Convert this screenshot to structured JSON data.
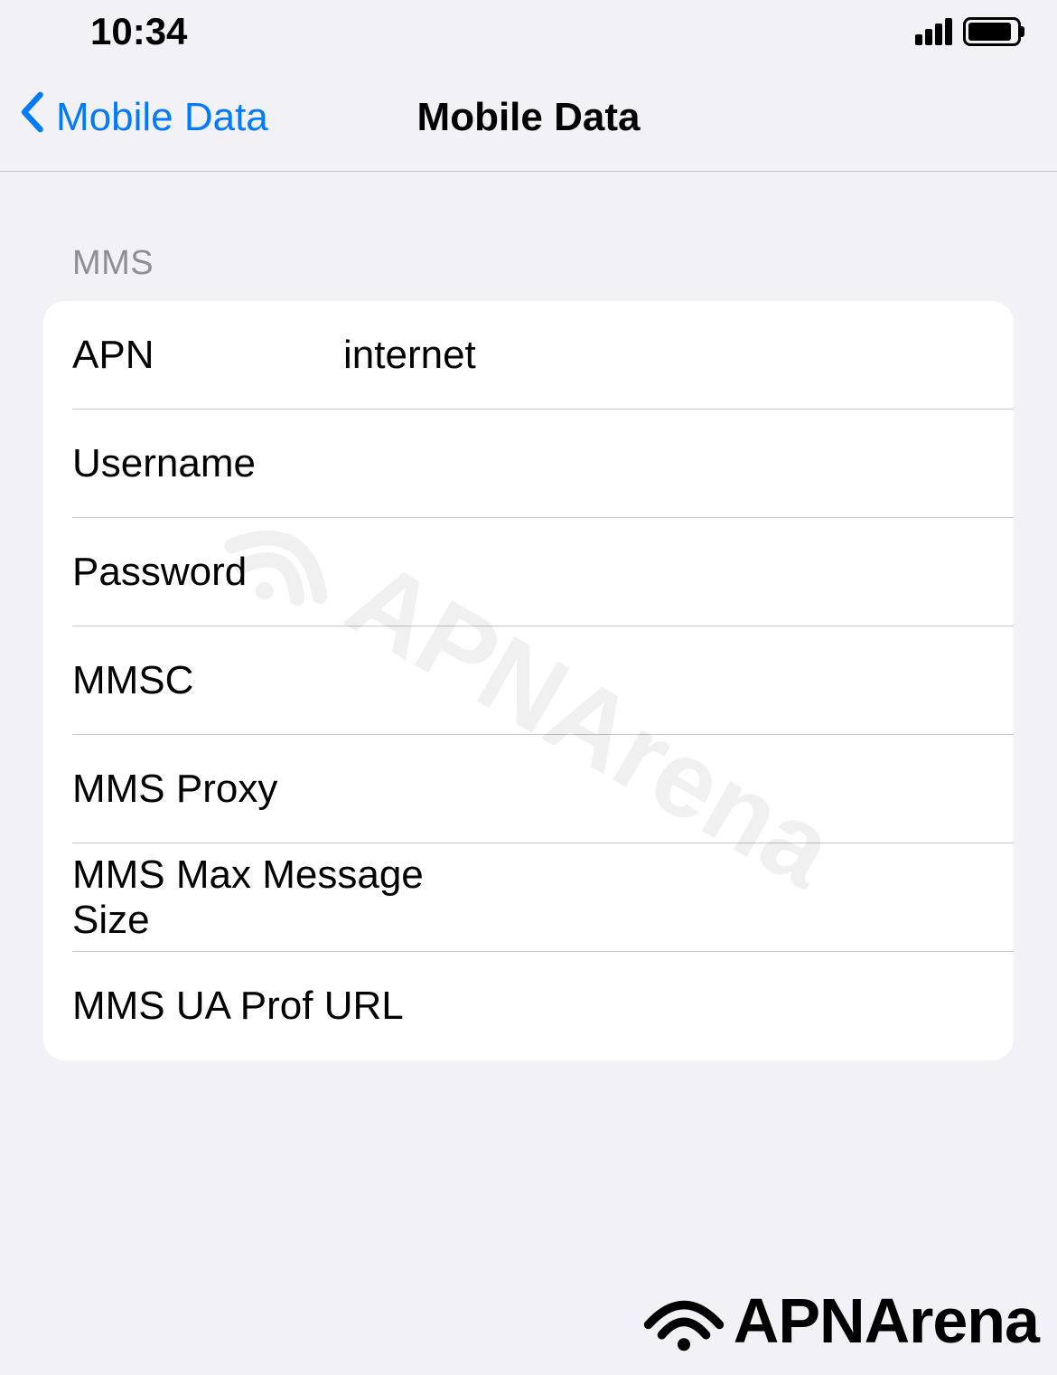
{
  "statusBar": {
    "time": "10:34"
  },
  "navBar": {
    "backLabel": "Mobile Data",
    "title": "Mobile Data"
  },
  "section": {
    "header": "MMS",
    "rows": [
      {
        "label": "APN",
        "value": "internet"
      },
      {
        "label": "Username",
        "value": ""
      },
      {
        "label": "Password",
        "value": ""
      },
      {
        "label": "MMSC",
        "value": ""
      },
      {
        "label": "MMS Proxy",
        "value": ""
      },
      {
        "label": "MMS Max Message Size",
        "value": ""
      },
      {
        "label": "MMS UA Prof URL",
        "value": ""
      }
    ]
  },
  "watermark": {
    "text": "APNArena"
  },
  "footerLogo": {
    "text": "APNArena"
  }
}
